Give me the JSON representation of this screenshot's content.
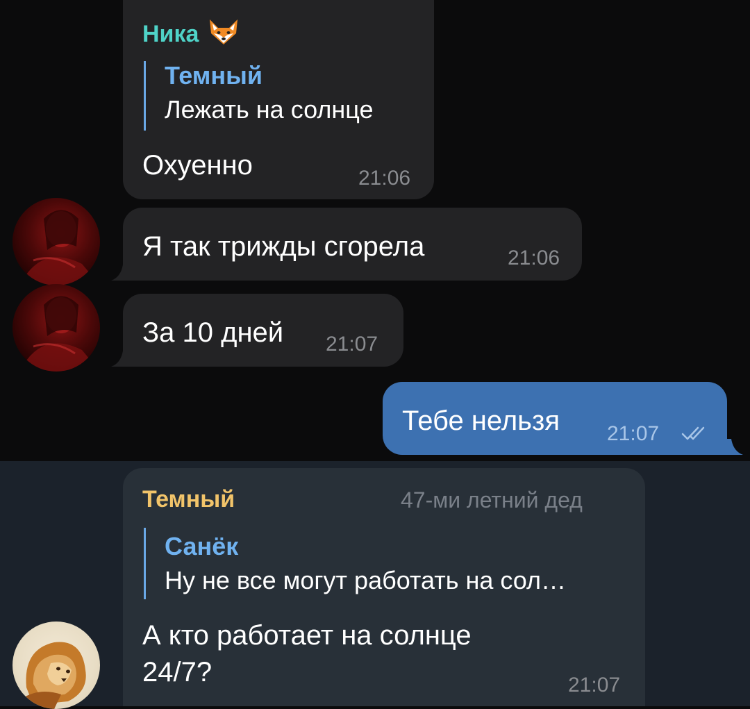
{
  "colors": {
    "background": "#0b0b0c",
    "highlight_background": "#1b222b",
    "incoming_bubble": "#232325",
    "outgoing_bubble": "#3d71b1",
    "nika_name": "#4fd3c8",
    "temny_name": "#f2c46a",
    "reply_accent": "#6aa8e6"
  },
  "messages": {
    "m1": {
      "sender": "Ника",
      "sender_emoji": "fox-face-emoji",
      "reply": {
        "name": "Темный",
        "text": "Лежать на солнце"
      },
      "text": "Охуенно",
      "time": "21:06"
    },
    "m2": {
      "text": "Я так трижды сгорела",
      "time": "21:06"
    },
    "m3": {
      "text": "За 10 дней",
      "time": "21:07"
    },
    "m4": {
      "text": "Тебе нельзя",
      "time": "21:07",
      "status_icon": "double-check-icon"
    },
    "m5": {
      "sender": "Темный",
      "admin_title": "47-ми летний дед",
      "reply": {
        "name": "Санёк",
        "text": "Ну не все могут работать на сол…"
      },
      "text_line1": "А кто работает на солнце",
      "text_line2": "24/7?",
      "time": "21:07"
    }
  }
}
